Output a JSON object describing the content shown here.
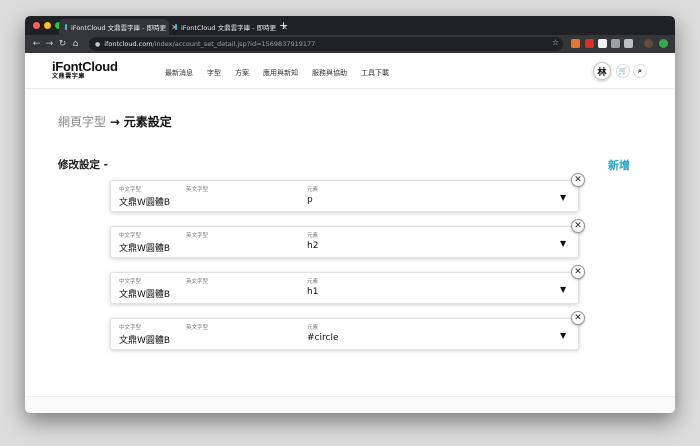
{
  "browser": {
    "tabs": [
      {
        "title": "iFontCloud 文鼎雲字庫 - 即時更"
      },
      {
        "title": "iFontCloud 文鼎雲字庫 - 即時更"
      }
    ],
    "url_host": "ifontcloud.com",
    "url_path": "/index/account_set_detail.jsp?id=1569837919177",
    "traffic_light_colors": [
      "#ff5f57",
      "#febc2e",
      "#28c840"
    ]
  },
  "site": {
    "logo_main": "iFontCloud",
    "logo_sub": "文鼎雲字庫",
    "nav": [
      "最新消息",
      "字型",
      "方案",
      "應用與新知",
      "服務與協助",
      "工具下載"
    ],
    "avatar": "林"
  },
  "page": {
    "breadcrumb_parent": "網頁字型",
    "breadcrumb_arrow": "→",
    "breadcrumb_current": "元素設定",
    "section_title": "修改設定 -",
    "add_new": "新增",
    "accent_color": "#27a3c7"
  },
  "labels": {
    "zh_font": "中文字型",
    "en_font": "英文字型",
    "element": "元素"
  },
  "rows": [
    {
      "zh_font": "文鼎W圓體B",
      "en_font": "",
      "element": "p"
    },
    {
      "zh_font": "文鼎W圓體B",
      "en_font": "",
      "element": "h2"
    },
    {
      "zh_font": "文鼎W圓體B",
      "en_font": "",
      "element": "h1"
    },
    {
      "zh_font": "文鼎W圓體B",
      "en_font": "",
      "element": "#circle"
    }
  ]
}
